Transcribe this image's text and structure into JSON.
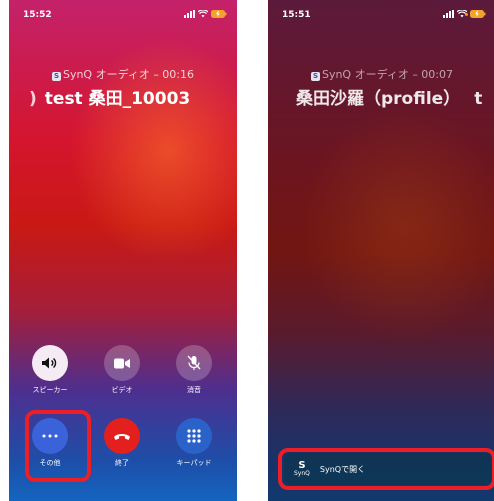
{
  "left": {
    "status_time": "15:52",
    "app_name": "SynQ",
    "call_info": "SynQ オーディオ – 00:16",
    "caller_name": "test 桑田_10003",
    "controls": [
      {
        "label": "スピーカー",
        "icon": "speaker-icon"
      },
      {
        "label": "ビデオ",
        "icon": "video-icon"
      },
      {
        "label": "消音",
        "icon": "mic-off-icon"
      },
      {
        "label": "その他",
        "icon": "more-icon"
      },
      {
        "label": "終了",
        "icon": "end-call-icon"
      },
      {
        "label": "キーパッド",
        "icon": "keypad-icon"
      }
    ],
    "highlight_color": "#ec1f26"
  },
  "right": {
    "status_time": "15:51",
    "call_info": "SynQ オーディオ – 00:07",
    "caller_name": "桑田沙羅（profile）",
    "caller_name_overflow": "t",
    "open_bar": {
      "logo_text": "SynQ",
      "label": "SynQで開く"
    }
  },
  "colors": {
    "end_call": "#e3201e",
    "more_button": "#3b63d9",
    "highlight": "#ec1f26"
  }
}
